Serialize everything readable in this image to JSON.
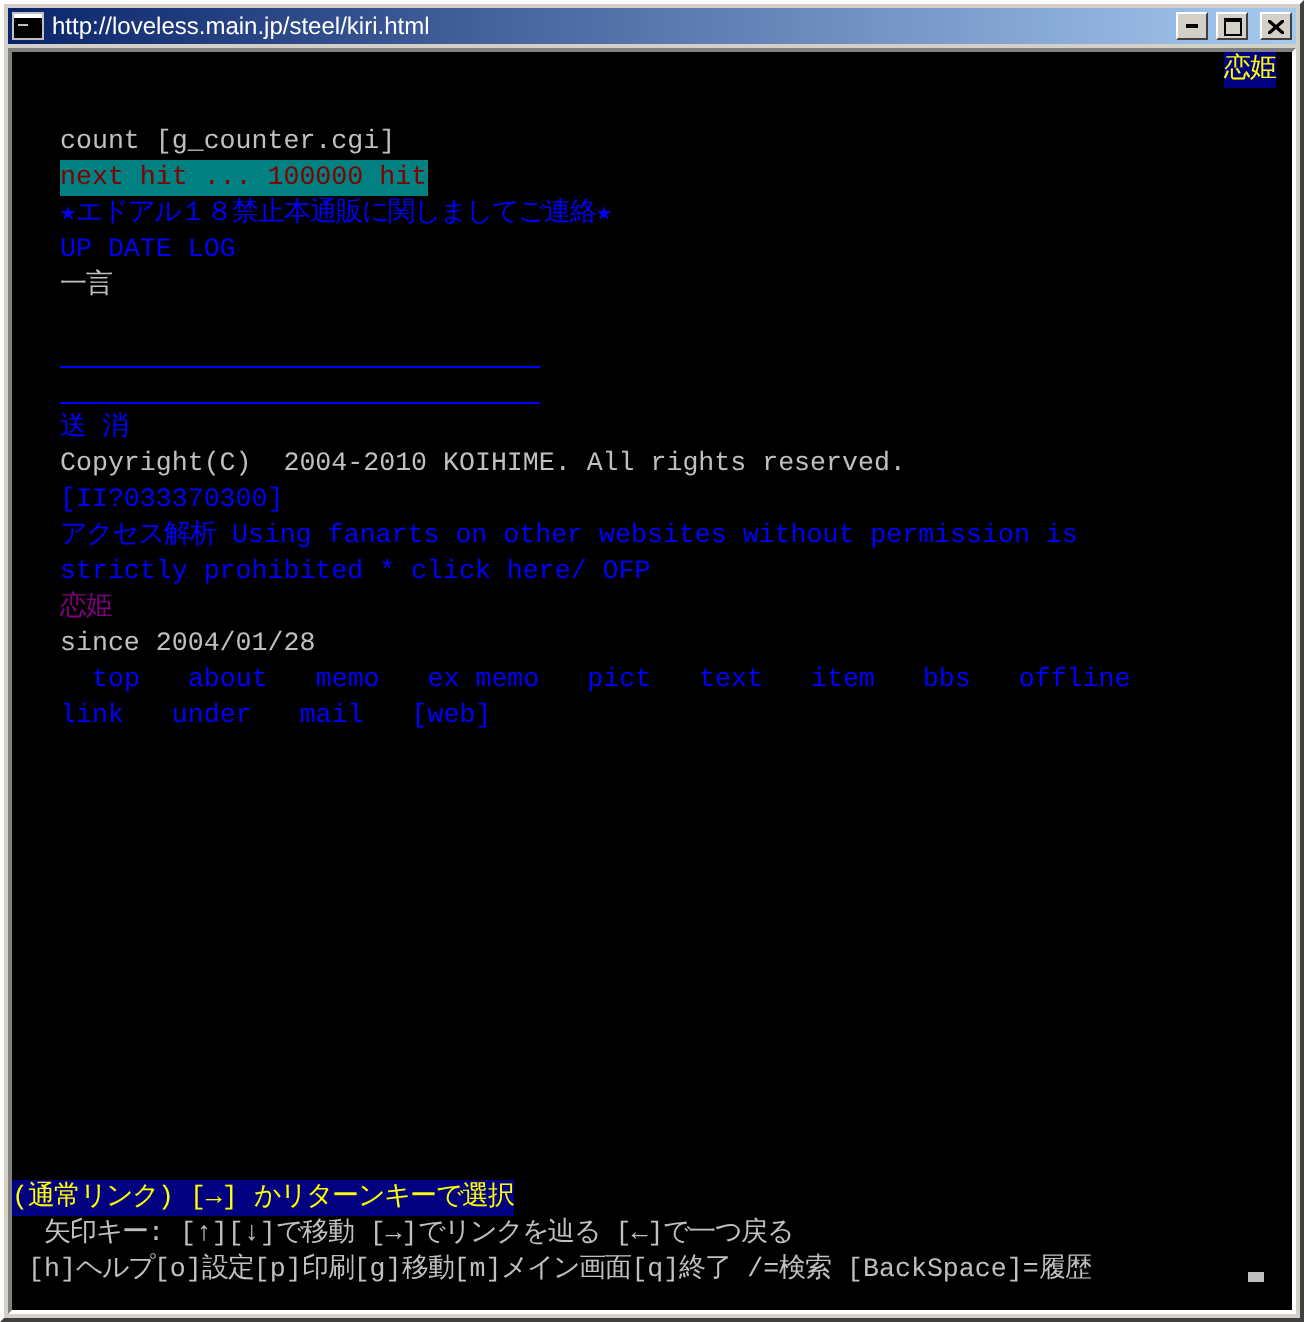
{
  "window": {
    "title": "http://loveless.main.jp/steel/kiri.html"
  },
  "corner_badge": "恋姫",
  "page": {
    "lines": [
      {
        "kind": "text",
        "text": "count [g_counter.cgi]",
        "color": "#c0c0c0"
      },
      {
        "kind": "highlight",
        "text": "next hit ... 100000 hit"
      },
      {
        "kind": "link",
        "text": "★エドアル１８禁止本通販に関しましてご連絡★",
        "color": "#0000ff"
      },
      {
        "kind": "link",
        "text": "UP DATE LOG",
        "color": "#0000ff"
      },
      {
        "kind": "text",
        "text": "一言",
        "color": "#c0c0c0"
      },
      {
        "kind": "field"
      },
      {
        "kind": "field"
      },
      {
        "kind": "buttons",
        "buttons": [
          "送",
          "消"
        ]
      },
      {
        "kind": "text",
        "text": "Copyright(C)  2004-2010 KOIHIME. All rights reserved.",
        "color": "#c0c0c0"
      },
      {
        "kind": "link",
        "text": "[II?033370300]",
        "color": "#0000ff"
      },
      {
        "kind": "link",
        "text": "アクセス解析 Using fanarts on other websites without permission is strictly prohibited * click here/ OFP",
        "color": "#0000ff"
      },
      {
        "kind": "text",
        "text": "恋姫",
        "color": "#800080"
      },
      {
        "kind": "text",
        "text": "since 2004/01/28",
        "color": "#c0c0c0"
      },
      {
        "kind": "nav",
        "indented": true,
        "links": [
          "top",
          "about",
          "memo",
          "ex memo",
          "pict",
          "text",
          "item",
          "bbs",
          "offline"
        ]
      },
      {
        "kind": "nav",
        "indented": false,
        "links": [
          "link",
          "under",
          "mail",
          "[web]"
        ]
      }
    ]
  },
  "status_lines": [
    {
      "kind": "status",
      "text": "(通常リンク) [→] かリターンキーで選択"
    },
    {
      "kind": "help",
      "text": "矢印キー: [↑][↓]で移動 [→]でリンクを辿る [←]で一つ戻る"
    },
    {
      "kind": "help",
      "text": "[h]ヘルプ[o]設定[p]印刷[g]移動[m]メイン画面[q]終了 /=検索 [BackSpace]=履歴"
    }
  ]
}
